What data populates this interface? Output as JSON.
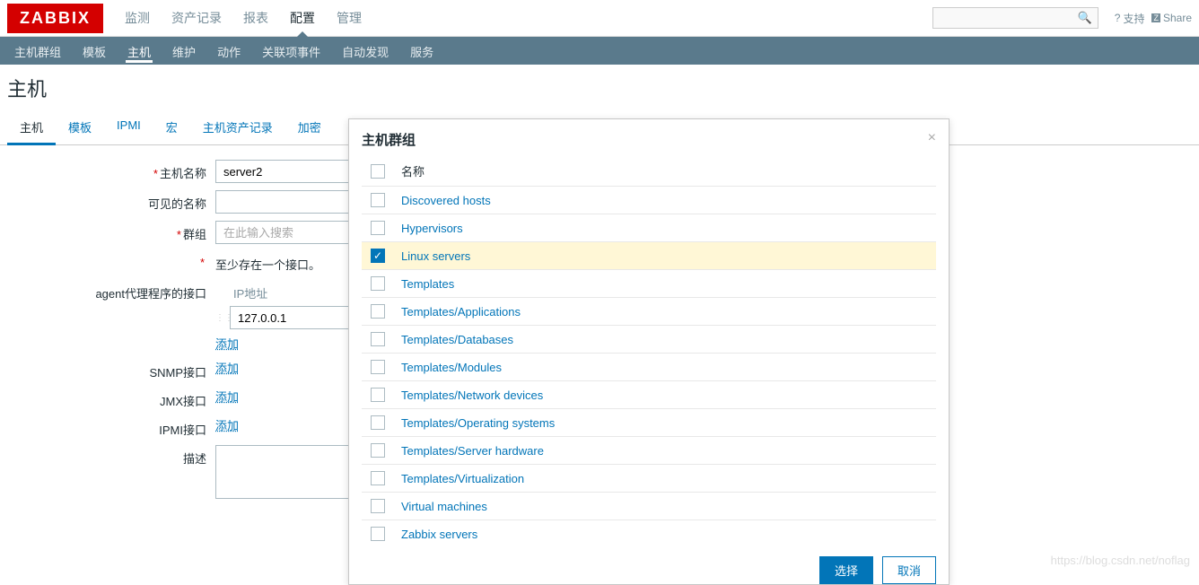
{
  "brand": "ZABBIX",
  "topnav": {
    "items": [
      "监测",
      "资产记录",
      "报表",
      "配置",
      "管理"
    ],
    "active_index": 3,
    "support": "支持",
    "share": "Share"
  },
  "subnav": {
    "items": [
      "主机群组",
      "模板",
      "主机",
      "维护",
      "动作",
      "关联项事件",
      "自动发现",
      "服务"
    ],
    "active_index": 2
  },
  "page_title": "主机",
  "tabs": {
    "items": [
      "主机",
      "模板",
      "IPMI",
      "宏",
      "主机资产记录",
      "加密"
    ],
    "active_index": 0
  },
  "form": {
    "host_name_label": "主机名称",
    "host_name_value": "server2",
    "visible_name_label": "可见的名称",
    "visible_name_value": "",
    "groups_label": "群组",
    "groups_placeholder": "在此输入搜索",
    "interface_required_text": "至少存在一个接口。",
    "agent_label": "agent代理程序的接口",
    "ip_header": "IP地址",
    "ip_value": "127.0.0.1",
    "add_label": "添加",
    "snmp_label": "SNMP接口",
    "jmx_label": "JMX接口",
    "ipmi_label": "IPMI接口",
    "desc_label": "描述",
    "desc_value": ""
  },
  "modal": {
    "title": "主机群组",
    "header_label": "名称",
    "groups": [
      {
        "name": "Discovered hosts",
        "checked": false
      },
      {
        "name": "Hypervisors",
        "checked": false
      },
      {
        "name": "Linux servers",
        "checked": true
      },
      {
        "name": "Templates",
        "checked": false
      },
      {
        "name": "Templates/Applications",
        "checked": false
      },
      {
        "name": "Templates/Databases",
        "checked": false
      },
      {
        "name": "Templates/Modules",
        "checked": false
      },
      {
        "name": "Templates/Network devices",
        "checked": false
      },
      {
        "name": "Templates/Operating systems",
        "checked": false
      },
      {
        "name": "Templates/Server hardware",
        "checked": false
      },
      {
        "name": "Templates/Virtualization",
        "checked": false
      },
      {
        "name": "Virtual machines",
        "checked": false
      },
      {
        "name": "Zabbix servers",
        "checked": false
      }
    ],
    "select_btn": "选择",
    "cancel_btn": "取消"
  },
  "watermark": "https://blog.csdn.net/noflag"
}
